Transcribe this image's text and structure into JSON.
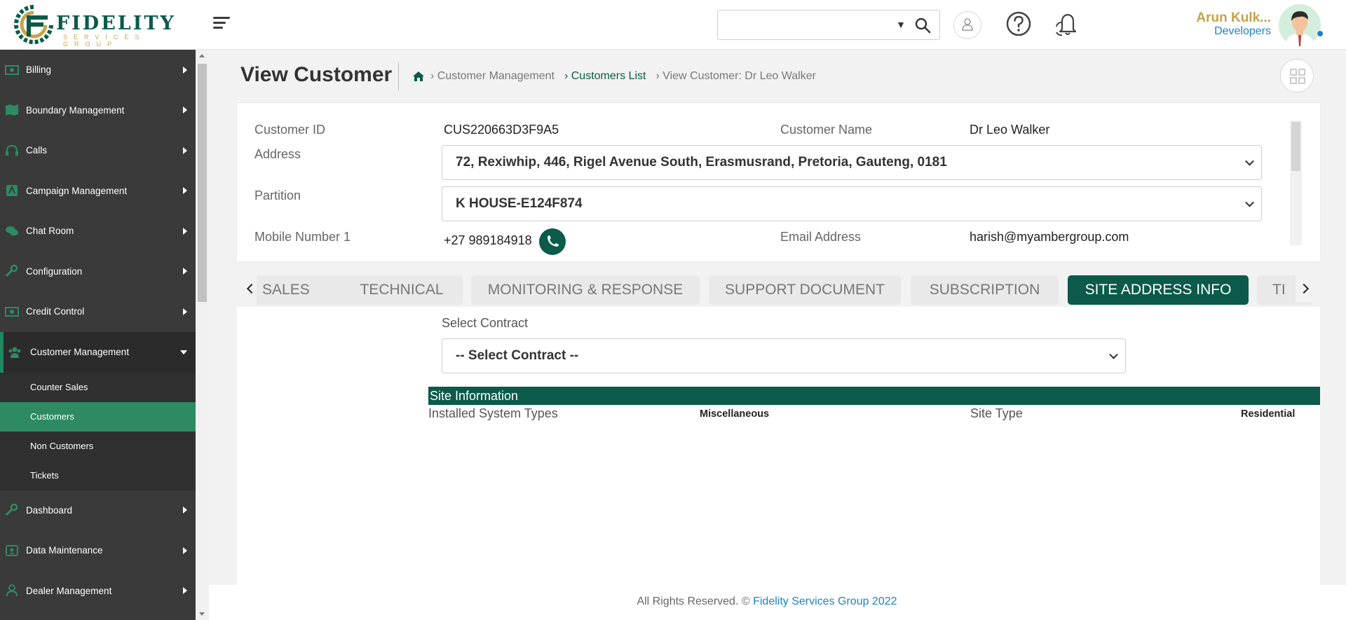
{
  "brand": {
    "name": "FIDELITY",
    "subtitle": "SERVICES GROUP"
  },
  "header": {
    "search_placeholder": "",
    "user_name": "Arun Kulk...",
    "user_role": "Developers"
  },
  "sidebar": {
    "items": [
      {
        "label": "Billing",
        "icon": "money-icon"
      },
      {
        "label": "Boundary Management",
        "icon": "map-icon"
      },
      {
        "label": "Calls",
        "icon": "headset-icon"
      },
      {
        "label": "Campaign Management",
        "icon": "campaign-icon"
      },
      {
        "label": "Chat Room",
        "icon": "chat-icon"
      },
      {
        "label": "Configuration",
        "icon": "wrench-icon"
      },
      {
        "label": "Credit Control",
        "icon": "money-icon"
      }
    ],
    "open_item": {
      "label": "Customer Management",
      "icon": "users-icon"
    },
    "sub_items": [
      "Counter Sales",
      "Customers",
      "Non Customers",
      "Tickets"
    ],
    "active_sub": "Customers",
    "items_after": [
      {
        "label": "Dashboard",
        "icon": "wrench-icon"
      },
      {
        "label": "Data Maintenance",
        "icon": "id-card-icon"
      },
      {
        "label": "Dealer Management",
        "icon": "user-icon"
      }
    ]
  },
  "page": {
    "title": "View Customer",
    "breadcrumb": {
      "item1": "› Customer Management",
      "item2": "› Customers List",
      "item3": "› View Customer: Dr Leo Walker"
    }
  },
  "customer": {
    "id_label": "Customer ID",
    "id_value": "CUS220663D3F9A5",
    "name_label": "Customer Name",
    "name_value": "Dr Leo Walker",
    "address_label": "Address",
    "address_value": "72, Rexiwhip, 446, Rigel Avenue South, Erasmusrand, Pretoria, Gauteng, 0181",
    "partition_label": "Partition",
    "partition_value": "K HOUSE-E124F874",
    "mobile_label": "Mobile Number 1",
    "mobile_value": "+27 989184918",
    "email_label": "Email Address",
    "email_value": "harish@myambergroup.com"
  },
  "tabs": {
    "sales": "SALES",
    "technical": "TECHNICAL",
    "monitoring": "MONITORING & RESPONSE",
    "support": "SUPPORT DOCUMENT",
    "subscription": "SUBSCRIPTION",
    "site_address": "SITE ADDRESS INFO",
    "next": "TI"
  },
  "site": {
    "contract_label": "Select Contract",
    "contract_value": "-- Select Contract --",
    "section_title": "Site Information",
    "installed_label": "Installed System Types",
    "installed_value": "Miscellaneous",
    "type_label": "Site Type",
    "type_value": "Residential"
  },
  "footer": {
    "text": "All Rights Reserved. ©",
    "brand": "Fidelity Services Group 2022"
  },
  "colors": {
    "primary": "#0b5a4a",
    "gold": "#c6a24a",
    "link_blue": "#1d83c4",
    "sidebar_bg": "#3a3a3a",
    "active_sub": "#2e8a63"
  }
}
